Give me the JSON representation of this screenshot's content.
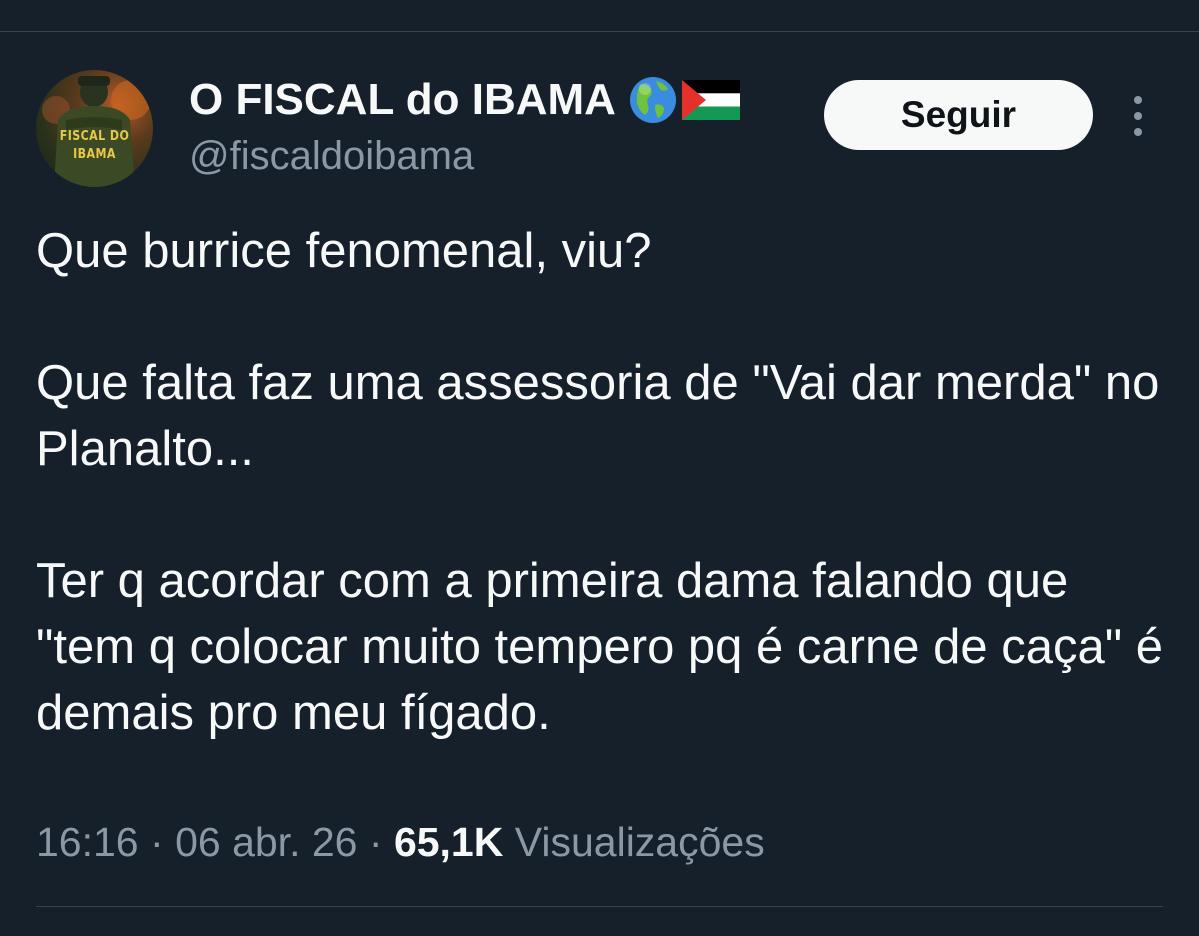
{
  "author": {
    "display_name": "O FISCAL do IBAMA",
    "handle": "@fiscaldoibama",
    "avatar_label_line1": "FISCAL DO",
    "avatar_label_line2": "IBAMA",
    "name_emojis": [
      "globe-americas-icon",
      "palestine-flag-icon"
    ]
  },
  "actions": {
    "follow_label": "Seguir",
    "more_icon": "more-vertical-icon"
  },
  "tweet": {
    "paragraphs": [
      "Que burrice fenomenal, viu?",
      "Que falta faz uma assessoria de \"Vai dar merda\" no Planalto...",
      "Ter q acordar com a primeira dama falando que \"tem q colocar muito tempero pq é carne de caça\" é demais pro meu fígado."
    ]
  },
  "meta": {
    "time": "16:16",
    "separator": "·",
    "date": "06 abr. 26",
    "views_count": "65,1K",
    "views_label": "Visualizações"
  },
  "colors": {
    "background": "#15202b",
    "primary_text": "#f7f9f9",
    "secondary_text": "#8b98a5",
    "divider": "#38444d",
    "avatar_text": "#e8c84a"
  }
}
